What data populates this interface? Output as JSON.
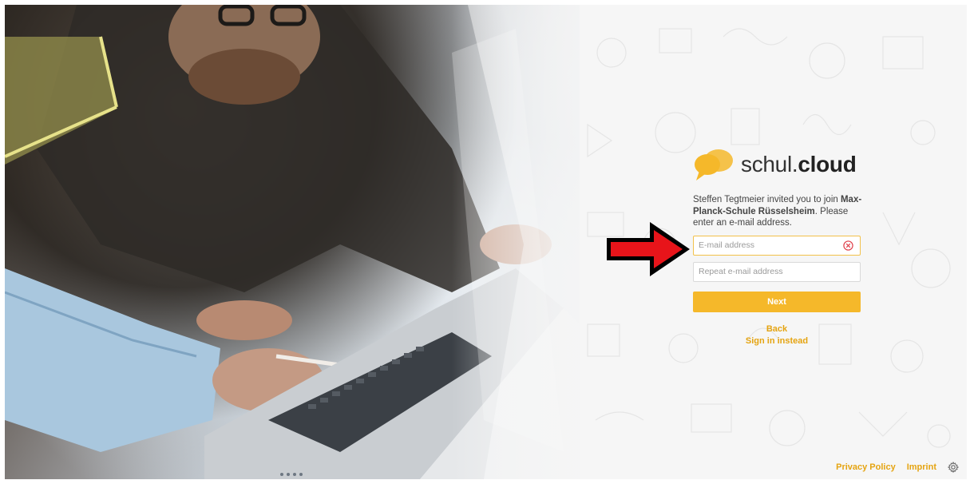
{
  "brand": {
    "logo_icon": "speech-bubbles-icon",
    "name_regular": "schul.",
    "name_bold": "cloud",
    "accent_color": "#f5b82a",
    "link_color": "#e5a411"
  },
  "invite": {
    "prefix": "Steffen Tegtmeier invited you to join ",
    "school": "Max-Planck-Schule Rüsselsheim",
    "suffix": ". Please enter an e-mail address."
  },
  "form": {
    "email_placeholder": "E-mail address",
    "email_value": "",
    "repeat_placeholder": "Repeat e-mail address",
    "repeat_value": "",
    "clear_icon": "clear-circle-icon",
    "next_label": "Next",
    "back_label": "Back",
    "signin_label": "Sign in instead"
  },
  "annotation": {
    "arrow_icon": "red-arrow-icon",
    "arrow_color": "#e8141a"
  },
  "footer": {
    "privacy_label": "Privacy Policy",
    "imprint_label": "Imprint",
    "settings_icon": "gear-icon"
  }
}
